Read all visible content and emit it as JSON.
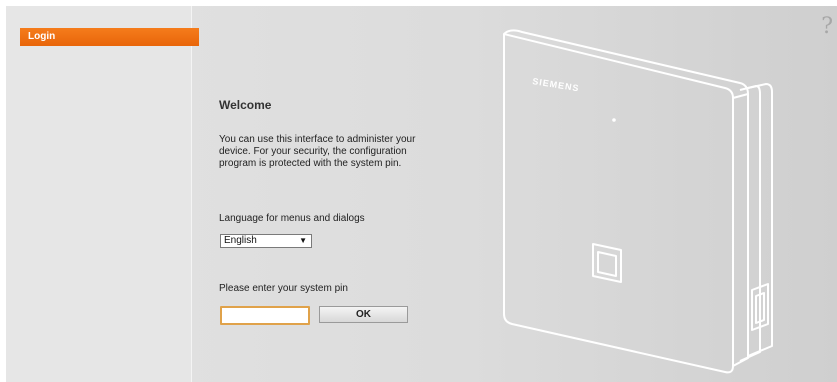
{
  "sidebar": {
    "items": [
      {
        "label": "Login"
      }
    ]
  },
  "header": {
    "help_icon": "help-icon",
    "help_glyph": "?"
  },
  "device": {
    "brand": "SIEMENS"
  },
  "main": {
    "title": "Welcome",
    "intro": "You can use this interface to administer your device. For your security, the configuration program is protected with the system pin.",
    "language": {
      "label": "Language for menus and dialogs",
      "selected": "English"
    },
    "pin": {
      "label": "Please enter your system pin",
      "value": "",
      "button": "OK"
    }
  },
  "colors": {
    "accent": "#ef6f0f",
    "pin_border": "#e0a24a",
    "background": "#dcdcdc"
  }
}
